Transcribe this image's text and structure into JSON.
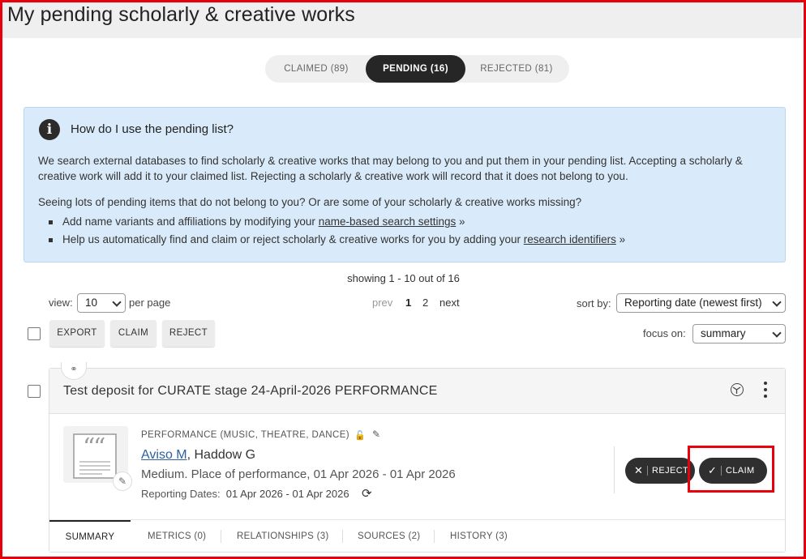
{
  "page": {
    "title": "My pending scholarly & creative works"
  },
  "status_tabs": [
    {
      "label": "CLAIMED (89)"
    },
    {
      "label": "PENDING (16)"
    },
    {
      "label": "REJECTED (81)"
    }
  ],
  "info": {
    "title": "How do I use the pending list?",
    "paragraph1": "We search external databases to find scholarly & creative works that may belong to you and put them in your pending list. Accepting a scholarly & creative work will add it to your claimed list. Rejecting a scholarly & creative work will record that it does not belong to you.",
    "paragraph2": "Seeing lots of pending items that do not belong to you? Or are some of your scholarly & creative works missing?",
    "item1_prefix": "Add name variants and affiliations by modifying your ",
    "item1_link": "name-based search settings",
    "item1_suffix": " »",
    "item2_prefix": "Help us automatically find and claim or reject scholarly & creative works for you by adding your ",
    "item2_link": "research identifiers",
    "item2_suffix": " »"
  },
  "listing": {
    "showing": "showing 1 - 10 out of 16",
    "view_label": "view:",
    "view_value": "10",
    "per_page": "per page",
    "prev": "prev",
    "page1": "1",
    "page2": "2",
    "next": "next",
    "sort_label": "sort by:",
    "sort_value": "Reporting date (newest first)",
    "focus_label": "focus on:",
    "focus_value": "summary"
  },
  "bulk_actions": {
    "export": "EXPORT",
    "claim": "CLAIM",
    "reject": "REJECT"
  },
  "item": {
    "title": "Test deposit for CURATE stage 24-April-2026 PERFORMANCE",
    "type": "PERFORMANCE (MUSIC, THEATRE, DANCE)",
    "author_link": "Aviso M",
    "author_rest": ", Haddow G",
    "medium": "Medium. Place of performance, 01 Apr 2026 - 01 Apr 2026",
    "reporting_label": "Reporting Dates:",
    "reporting_value": "01 Apr 2026 - 01 Apr 2026",
    "reject_label": "REJECT",
    "claim_label": "CLAIM",
    "tabs": [
      {
        "label": "SUMMARY"
      },
      {
        "label": "METRICS (0)"
      },
      {
        "label": "RELATIONSHIPS (3)"
      },
      {
        "label": "SOURCES (2)"
      },
      {
        "label": "HISTORY (3)"
      }
    ]
  },
  "colors": {
    "accent_dark": "#262626",
    "info_bg": "#d9ebfa",
    "link": "#2e5fa0",
    "highlight": "#e8000b"
  },
  "icons": [
    "info-icon",
    "link-icon",
    "open-access-icon",
    "more-options-icon",
    "quote-document-icon",
    "edit-icon",
    "lock-icon",
    "refresh-icon",
    "close-icon",
    "check-icon",
    "chevron-down-icon"
  ]
}
